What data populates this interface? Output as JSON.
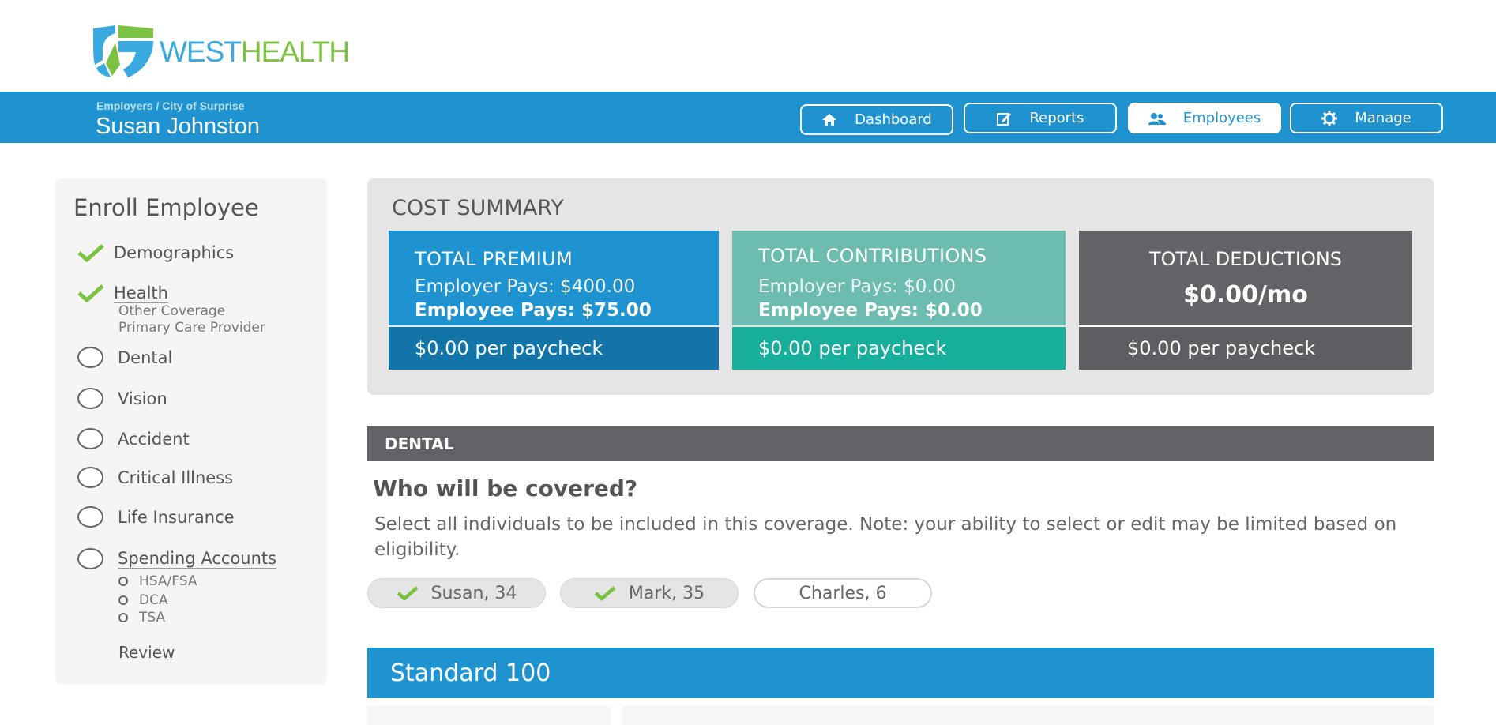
{
  "brand": {
    "word_west": "WEST",
    "word_health": "HEALTH",
    "colors": {
      "blue": "#3aa9e0",
      "green": "#7cc242"
    }
  },
  "header": {
    "breadcrumb": "Employers / City of Surprise",
    "name": "Susan Johnston",
    "accent": "#1f93d0",
    "nav": [
      {
        "label": "Dashboard",
        "icon": "home-icon",
        "active": false
      },
      {
        "label": "Reports",
        "icon": "edit-icon",
        "active": false
      },
      {
        "label": "Employees",
        "icon": "users-icon",
        "active": true
      },
      {
        "label": "Manage",
        "icon": "gear-icon",
        "active": false
      }
    ]
  },
  "sidebar": {
    "title": "Enroll Employee",
    "steps": [
      {
        "label": "Demographics",
        "status": "complete"
      },
      {
        "label": "Health",
        "status": "complete",
        "sub": [
          "Other Coverage",
          "Primary Care Provider"
        ]
      },
      {
        "label": "Dental",
        "status": "incomplete"
      },
      {
        "label": "Vision",
        "status": "incomplete"
      },
      {
        "label": "Accident",
        "status": "incomplete"
      },
      {
        "label": "Critical Illness",
        "status": "incomplete"
      },
      {
        "label": "Life Insurance",
        "status": "incomplete"
      },
      {
        "label": "Spending Accounts",
        "status": "incomplete",
        "sub": [
          "HSA/FSA",
          "DCA",
          "TSA"
        ]
      }
    ],
    "review": "Review"
  },
  "summary": {
    "title": "COST SUMMARY",
    "premium": {
      "heading": "TOTAL PREMIUM",
      "employer": "Employer Pays: $400.00",
      "employee": "Employee Pays: $75.00",
      "per_paycheck": "$0.00 per paycheck"
    },
    "contributions": {
      "heading": "TOTAL CONTRIBUTIONS",
      "employer": "Employer Pays: $0.00",
      "employee": "Employee Pays: $0.00",
      "per_paycheck": "$0.00 per paycheck"
    },
    "deductions": {
      "heading": "TOTAL DEDUCTIONS",
      "amount": "$0.00/mo",
      "per_paycheck": "$0.00 per paycheck"
    }
  },
  "dental": {
    "section_label": "DENTAL",
    "question": "Who will be covered?",
    "description": "Select all individuals to be included in this coverage.  Note: your ability to select or edit may be limited based on eligibility.",
    "members": [
      {
        "label": "Susan, 34",
        "selected": true
      },
      {
        "label": "Mark, 35",
        "selected": true
      },
      {
        "label": "Charles, 6",
        "selected": false
      }
    ],
    "plan_name": "Standard 100"
  }
}
